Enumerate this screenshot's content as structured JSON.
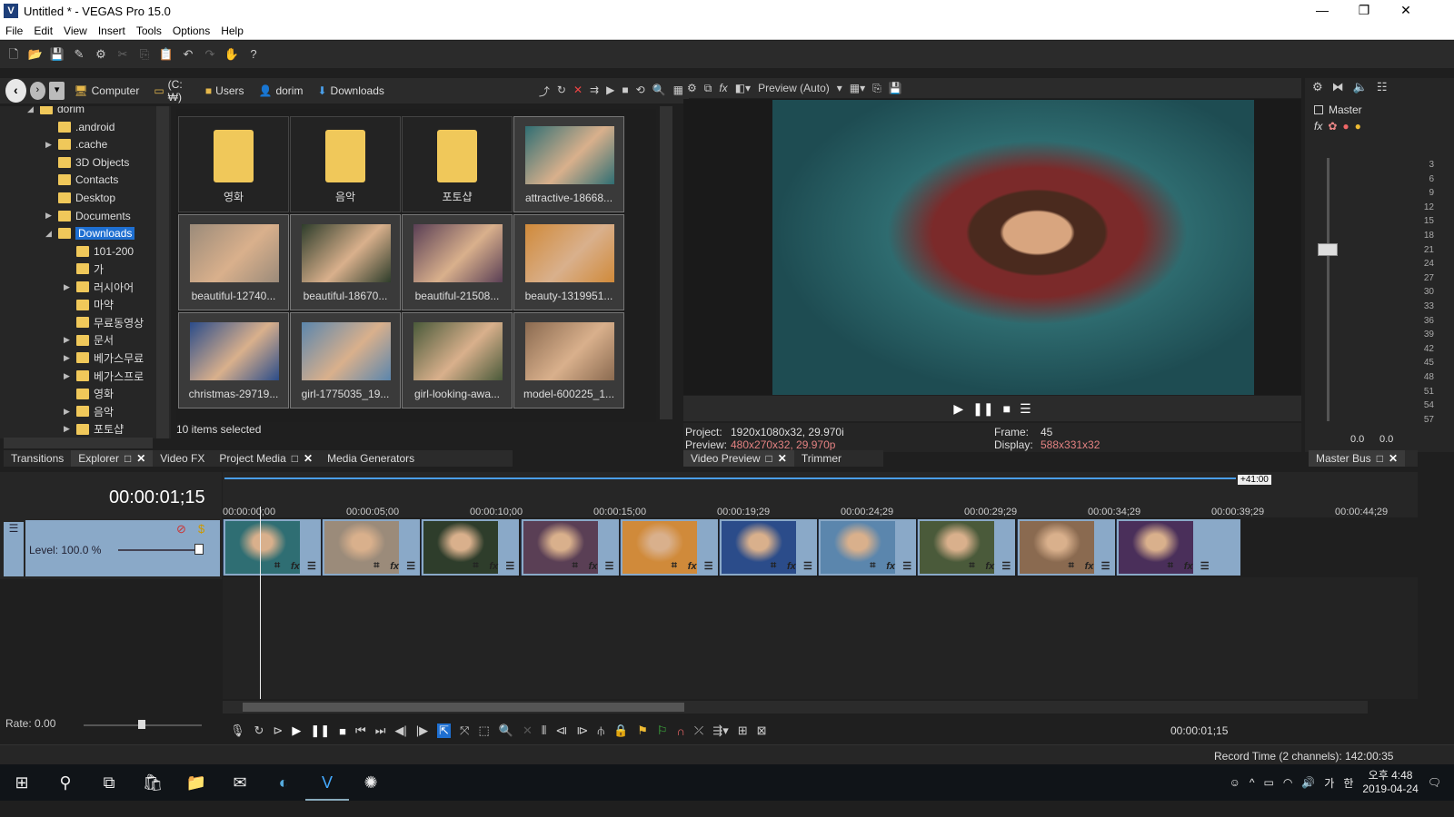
{
  "window": {
    "title": "Untitled * - VEGAS Pro 15.0",
    "min": "—",
    "max": "❐",
    "close": "✕"
  },
  "menu": [
    "File",
    "Edit",
    "View",
    "Insert",
    "Tools",
    "Options",
    "Help"
  ],
  "explorer": {
    "breadcrumbs": [
      "Computer",
      "(C:₩)",
      "Users",
      "dorim",
      "Downloads"
    ],
    "tree": [
      {
        "label": "dorim",
        "depth": 0,
        "arrow": "◢"
      },
      {
        "label": ".android",
        "depth": 1,
        "arrow": ""
      },
      {
        "label": ".cache",
        "depth": 1,
        "arrow": "▶"
      },
      {
        "label": "3D Objects",
        "depth": 1,
        "arrow": ""
      },
      {
        "label": "Contacts",
        "depth": 1,
        "arrow": ""
      },
      {
        "label": "Desktop",
        "depth": 1,
        "arrow": ""
      },
      {
        "label": "Documents",
        "depth": 1,
        "arrow": "▶"
      },
      {
        "label": "Downloads",
        "depth": 1,
        "arrow": "◢",
        "selected": true
      },
      {
        "label": "101-200",
        "depth": 2,
        "arrow": ""
      },
      {
        "label": "가",
        "depth": 2,
        "arrow": ""
      },
      {
        "label": "러시아어",
        "depth": 2,
        "arrow": "▶"
      },
      {
        "label": "마약",
        "depth": 2,
        "arrow": ""
      },
      {
        "label": "무료동영상",
        "depth": 2,
        "arrow": ""
      },
      {
        "label": "문서",
        "depth": 2,
        "arrow": "▶"
      },
      {
        "label": "베가스무료",
        "depth": 2,
        "arrow": "▶"
      },
      {
        "label": "베가스프로",
        "depth": 2,
        "arrow": "▶"
      },
      {
        "label": "영화",
        "depth": 2,
        "arrow": ""
      },
      {
        "label": "음악",
        "depth": 2,
        "arrow": "▶"
      },
      {
        "label": "포토샵",
        "depth": 2,
        "arrow": "▶"
      }
    ],
    "items": [
      {
        "label": "영화",
        "type": "folder",
        "selected": false,
        "color": "#f0c85a"
      },
      {
        "label": "음악",
        "type": "folder",
        "selected": false,
        "color": "#f0c85a"
      },
      {
        "label": "포토샵",
        "type": "folder",
        "selected": false,
        "color": "#f0c85a"
      },
      {
        "label": "attractive-18668...",
        "type": "image",
        "selected": true,
        "color": "#2f6e73"
      },
      {
        "label": "beautiful-12740...",
        "type": "image",
        "selected": true,
        "color": "#9b8b7a"
      },
      {
        "label": "beautiful-18670...",
        "type": "image",
        "selected": true,
        "color": "#2e3d2b"
      },
      {
        "label": "beautiful-21508...",
        "type": "image",
        "selected": true,
        "color": "#5a3f55"
      },
      {
        "label": "beauty-1319951...",
        "type": "image",
        "selected": true,
        "color": "#d08a3a"
      },
      {
        "label": "christmas-29719...",
        "type": "image",
        "selected": true,
        "color": "#2b4c8a"
      },
      {
        "label": "girl-1775035_19...",
        "type": "image",
        "selected": true,
        "color": "#5b86ad"
      },
      {
        "label": "girl-looking-awa...",
        "type": "image",
        "selected": true,
        "color": "#4a5a3a"
      },
      {
        "label": "model-600225_1...",
        "type": "image",
        "selected": true,
        "color": "#8a6a50"
      }
    ],
    "status": "10 items selected"
  },
  "left_tabs": [
    "Transitions",
    "Explorer",
    "Video FX",
    "Project Media",
    "Media Generators"
  ],
  "preview": {
    "mode": "Preview (Auto)",
    "project_label": "Project:",
    "project": "1920x1080x32, 29.970i",
    "preview_label": "Preview:",
    "preview": "480x270x32, 29.970p",
    "frame_label": "Frame:",
    "frame": "45",
    "display_label": "Display:",
    "display": "588x331x32",
    "tabs": [
      "Video Preview",
      "Trimmer"
    ]
  },
  "master": {
    "label": "Master",
    "ticks": [
      "3",
      "6",
      "9",
      "12",
      "15",
      "18",
      "21",
      "24",
      "27",
      "30",
      "33",
      "36",
      "39",
      "42",
      "45",
      "48",
      "51",
      "54",
      "57"
    ],
    "left_val": "0.0",
    "right_val": "0.0",
    "tab": "Master Bus"
  },
  "timeline": {
    "timecode": "00:00:01;15",
    "level": "Level: 100.0 %",
    "end_marker": "+41:00",
    "ruler": [
      "00:00:00;00",
      "00:00:05;00",
      "00:00:10;00",
      "00:00:15;00",
      "00:00:19;29",
      "00:00:24;29",
      "00:00:29;29",
      "00:00:34;29",
      "00:00:39;29",
      "00:00:44;29"
    ],
    "clip_colors": [
      "#2f6e73",
      "#9b8b7a",
      "#2e3d2b",
      "#5a3f55",
      "#d08a3a",
      "#2b4c8a",
      "#5b86ad",
      "#4a5a3a",
      "#8a6a50",
      "#4a2f5a"
    ],
    "rate": "Rate: 0.00",
    "cursor_time": "00:00:01;15",
    "record_time": "Record Time (2 channels): 142:00:35"
  },
  "taskbar": {
    "time": "오후 4:48",
    "date": "2019-04-24",
    "ime": "가",
    "ime2": "한"
  }
}
